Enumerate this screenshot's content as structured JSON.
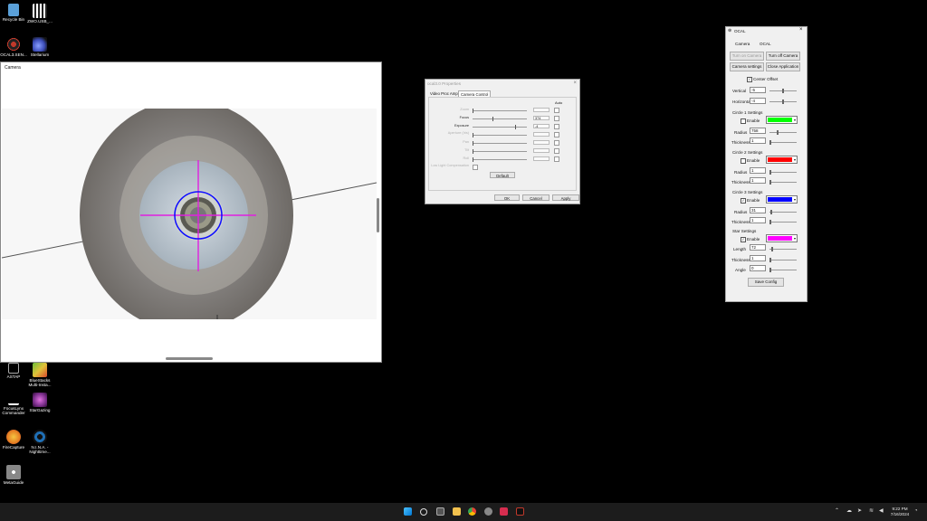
{
  "desktop": {
    "icons": [
      {
        "label": "Recycle Bin",
        "icon": "recycle-bin-icon",
        "color": "#5aa0d8"
      },
      {
        "label": "ZWO.USB_...",
        "icon": "qr-code-icon",
        "color": "#dddddd"
      },
      {
        "label": "OCAL3.SEN...",
        "icon": "ocal-app-icon",
        "color": "#c0392b"
      },
      {
        "label": "Stellarium",
        "icon": "stellarium-icon",
        "color": "#3b4cb8"
      },
      {
        "label": "ASTAP",
        "icon": "astap-icon",
        "color": "#777777"
      },
      {
        "label": "BlueStacks Multi-Insta...",
        "icon": "bluestacks-icon",
        "color": "#6dbf3a"
      },
      {
        "label": "FocusLynx Commander",
        "icon": "focuslynx-icon",
        "color": "#000000"
      },
      {
        "label": "StarGazing",
        "icon": "stargazing-icon",
        "color": "#7a2e8a"
      },
      {
        "label": "FireCapture",
        "icon": "firecapture-icon",
        "color": "#e67e22"
      },
      {
        "label": "N.I.N.A. - Nighttime...",
        "icon": "nina-icon",
        "color": "#1f6fb5"
      },
      {
        "label": "MetaGuide",
        "icon": "metaguide-icon",
        "color": "#888888"
      }
    ]
  },
  "camera_window": {
    "title": "Camera",
    "overlay_colors": {
      "crosshair": "#e020e0",
      "circle": "#1010ff"
    }
  },
  "properties_dialog": {
    "title": "ocal3.0 Properties",
    "tabs": [
      "Video Proc Amp",
      "Camera Control"
    ],
    "auto_header": "Auto",
    "rows": [
      {
        "label": "Zoom",
        "value": "",
        "enabled": false
      },
      {
        "label": "Focus",
        "value": "374",
        "enabled": true
      },
      {
        "label": "Exposure",
        "value": "-4",
        "enabled": true
      },
      {
        "label": "Aperture (Iris)",
        "value": "",
        "enabled": false
      },
      {
        "label": "Pan",
        "value": "",
        "enabled": false
      },
      {
        "label": "Tilt",
        "value": "",
        "enabled": false
      },
      {
        "label": "Roll",
        "value": "",
        "enabled": false
      }
    ],
    "low_light": "Low Light Compensation",
    "default_button": "Default",
    "ok_button": "OK",
    "cancel_button": "Cancel",
    "apply_button": "Apply"
  },
  "ocal": {
    "title": "OCAL",
    "menu": [
      "Camera",
      "OCAL"
    ],
    "turn_on": "Turn on Camera",
    "turn_off": "Turn off Camera",
    "camera_settings": "Camera settings",
    "close_app": "Close Application",
    "center_offset": "Center Offset",
    "vertical_label": "Vertical",
    "vertical_value": "-5",
    "horizontal_label": "Horizontal",
    "horizontal_value": "-4",
    "circle1": {
      "title": "Circle 1 Settings",
      "enable": "Enable",
      "color": "#00ff00",
      "radius_label": "Radius",
      "radius": "758",
      "thickness_label": "Thickness",
      "thickness": "1"
    },
    "circle2": {
      "title": "Circle 2 Settings",
      "enable": "Enable",
      "color": "#ff0000",
      "radius_label": "Radius",
      "radius": "1",
      "thickness_label": "Thickness",
      "thickness": "1"
    },
    "circle3": {
      "title": "Circle 3 Settings",
      "enable": "Enable",
      "color": "#0000ff",
      "radius_label": "Radius",
      "radius": "31",
      "thickness_label": "Thickness",
      "thickness": "1"
    },
    "star": {
      "title": "Star Settings",
      "enable": "Enable",
      "color": "#ff00ff",
      "length_label": "Length",
      "length": "72",
      "thickness_label": "Thickness",
      "thickness": "1",
      "angle_label": "Angle",
      "angle": "0"
    },
    "save_config": "Save Config"
  },
  "taskbar": {
    "time": "9:22 PM",
    "date": "7/16/2024"
  }
}
